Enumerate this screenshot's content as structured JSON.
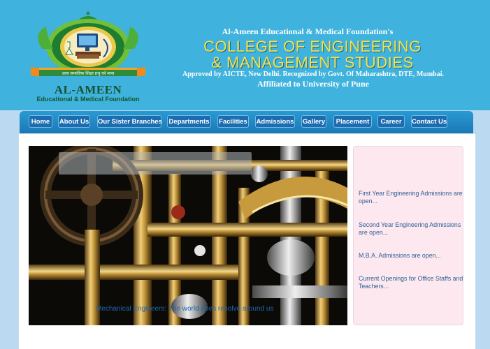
{
  "header": {
    "logo_name": "AL-AMEEN",
    "logo_sub": "Educational & Medical Foundation",
    "logo_motto": "उदय समाजिक शिक्षा प्रभु को माना",
    "foundation": "Al-Ameen Educational & Medical Foundation's",
    "college_line1": "COLLEGE OF ENGINEERING",
    "college_line2": "& MANAGEMENT STUDIES",
    "approved": "Approved by AICTE, New Delhi. Recognized by Govt. Of Maharashtra, DTE, Mumbai.",
    "affiliated": "Affiliated to University of Pune"
  },
  "nav": {
    "items": [
      {
        "label": "Home"
      },
      {
        "label": "About Us"
      },
      {
        "label": "Our Sister Branches"
      },
      {
        "label": "Departments"
      },
      {
        "label": "Facilities"
      },
      {
        "label": "Admissions"
      },
      {
        "label": "Gallery"
      },
      {
        "label": "Placement"
      },
      {
        "label": "Career"
      },
      {
        "label": "Contact Us"
      }
    ]
  },
  "hero": {
    "caption": "Mechanical Engineers: The world does resolve around us"
  },
  "news": {
    "items": [
      {
        "text": "First Year Engineering Admissions are open..."
      },
      {
        "text": "Second Year Engineering Admissions are open..."
      },
      {
        "text": "M.B.A. Admissions are open..."
      },
      {
        "text": "Current Openings for Office Staffs and Teachers..."
      }
    ]
  },
  "colors": {
    "header_bg": "#3fb3dd",
    "title_yellow": "#f5e24a",
    "nav_button": "#1c6cb0",
    "news_bg": "#fde8ef",
    "link_blue": "#2c5f96"
  }
}
